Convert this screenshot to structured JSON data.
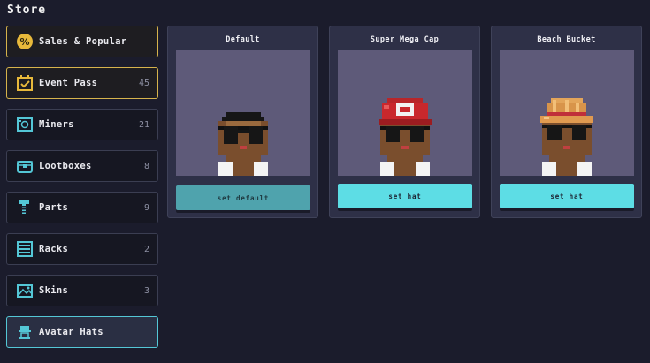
{
  "header": {
    "title": "Store"
  },
  "sidebar": {
    "items": [
      {
        "label": "Sales & Popular",
        "count": "",
        "icon": "percent-icon"
      },
      {
        "label": "Event Pass",
        "count": "45",
        "icon": "calendar-check-icon"
      },
      {
        "label": "Miners",
        "count": "21",
        "icon": "miner-icon"
      },
      {
        "label": "Lootboxes",
        "count": "8",
        "icon": "lootbox-icon"
      },
      {
        "label": "Parts",
        "count": "9",
        "icon": "screw-icon"
      },
      {
        "label": "Racks",
        "count": "2",
        "icon": "rack-icon"
      },
      {
        "label": "Skins",
        "count": "3",
        "icon": "skin-icon"
      },
      {
        "label": "Avatar Hats",
        "count": "",
        "icon": "avatar-hat-icon"
      }
    ]
  },
  "cards": [
    {
      "title": "Default",
      "button": "set default",
      "hat": "none"
    },
    {
      "title": "Super Mega Cap",
      "button": "set hat",
      "hat": "red-cap"
    },
    {
      "title": "Beach Bucket",
      "button": "set hat",
      "hat": "straw-hat"
    }
  ],
  "colors": {
    "background": "#1b1c2c",
    "accent": "#5ddde5",
    "gold_border": "#d6b34c",
    "active_border": "#54c7d6"
  }
}
